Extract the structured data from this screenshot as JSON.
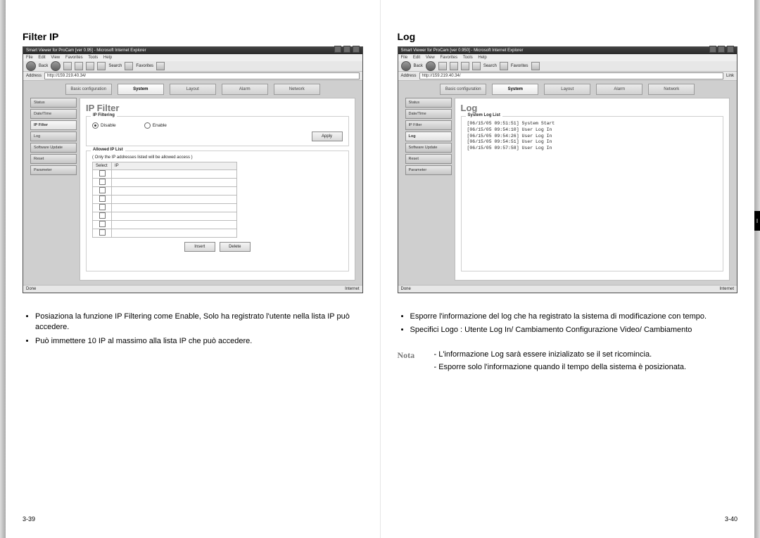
{
  "left": {
    "title": "Filter IP",
    "page_number": "3-39",
    "browser": {
      "window_title": "Smart Viewer for ProCam [ver 0.95] - Microsoft Internet Explorer",
      "menu": [
        "File",
        "Edit",
        "View",
        "Favorites",
        "Tools",
        "Help"
      ],
      "toolbar": {
        "back": "Back",
        "search": "Search",
        "favorites": "Favorites"
      },
      "address_label": "Address",
      "address_value": "http://159.219.40.34/",
      "status_done": "Done",
      "status_net": "Internet"
    },
    "tabs": {
      "items": [
        "Basic configuration",
        "System",
        "Layout",
        "Alarm",
        "Network"
      ],
      "active": 1
    },
    "sidebar": {
      "items": [
        "Status",
        "Date/Time",
        "IP Filter",
        "Log",
        "Software Update",
        "Reset",
        "Parameter"
      ],
      "active": 2
    },
    "panel": {
      "title": "IP Filter",
      "ipFiltering": {
        "legend": "IP Filtering",
        "disable": "Disable",
        "enable": "Enable",
        "apply": "Apply"
      },
      "allowed": {
        "legend": "Allowed IP List",
        "desc": "( Only the IP addresses listed will be allowed access )",
        "col_select": "Select",
        "col_ip": "IP",
        "insert": "Insert",
        "delete": "Delete",
        "rows": 8
      }
    },
    "bullets": [
      "Posiaziona la funzione IP Filtering come Enable, Solo ha registrato l'utente nella lista IP può accedere.",
      "Può immettere 10 IP al massimo  alla lista IP che può accedere."
    ]
  },
  "right": {
    "title": "Log",
    "page_number": "3-40",
    "browser": {
      "window_title": "Smart Viewer for ProCam [ver 0.950] - Microsoft Internet Explorer",
      "menu": [
        "File",
        "Edit",
        "View",
        "Favorites",
        "Tools",
        "Help"
      ],
      "toolbar": {
        "back": "Back",
        "search": "Search",
        "favorites": "Favorites"
      },
      "address_label": "Address",
      "address_value": "http://159.219.40.34/",
      "link_label": "Link",
      "status_done": "Done",
      "status_net": "Internet"
    },
    "tabs": {
      "items": [
        "Basic configuration",
        "System",
        "Layout",
        "Alarm",
        "Network"
      ],
      "active": 1
    },
    "sidebar": {
      "items": [
        "Status",
        "Date/Time",
        "IP Filter",
        "Log",
        "Software Update",
        "Reset",
        "Parameter"
      ],
      "active": 3
    },
    "panel": {
      "title": "Log",
      "legend": "System Log List",
      "entries": [
        "[06/15/05 09:51:51]  System Start",
        "[06/15/05 09:54:10]  User Log In",
        "[06/15/05 09:54:26]  User Log In",
        "[06/15/05 09:54:51]  User Log In",
        "[06/15/05 09:57:58]  User Log In"
      ]
    },
    "bullets": [
      "Esporre l'informazione del log che ha registrato la sistema di modificazione con tempo.",
      "Specifici Logo : Utente Log In/ Cambiamento Configurazione Video/ Cambiamento"
    ],
    "nota_label": "Nota",
    "nota_items": [
      "- L'informazione Log sarà essere inizializato se il set ricomincia.",
      "- Esporre solo l'informazione quando il tempo della sistema è posizionata."
    ],
    "side_tab": "I"
  }
}
